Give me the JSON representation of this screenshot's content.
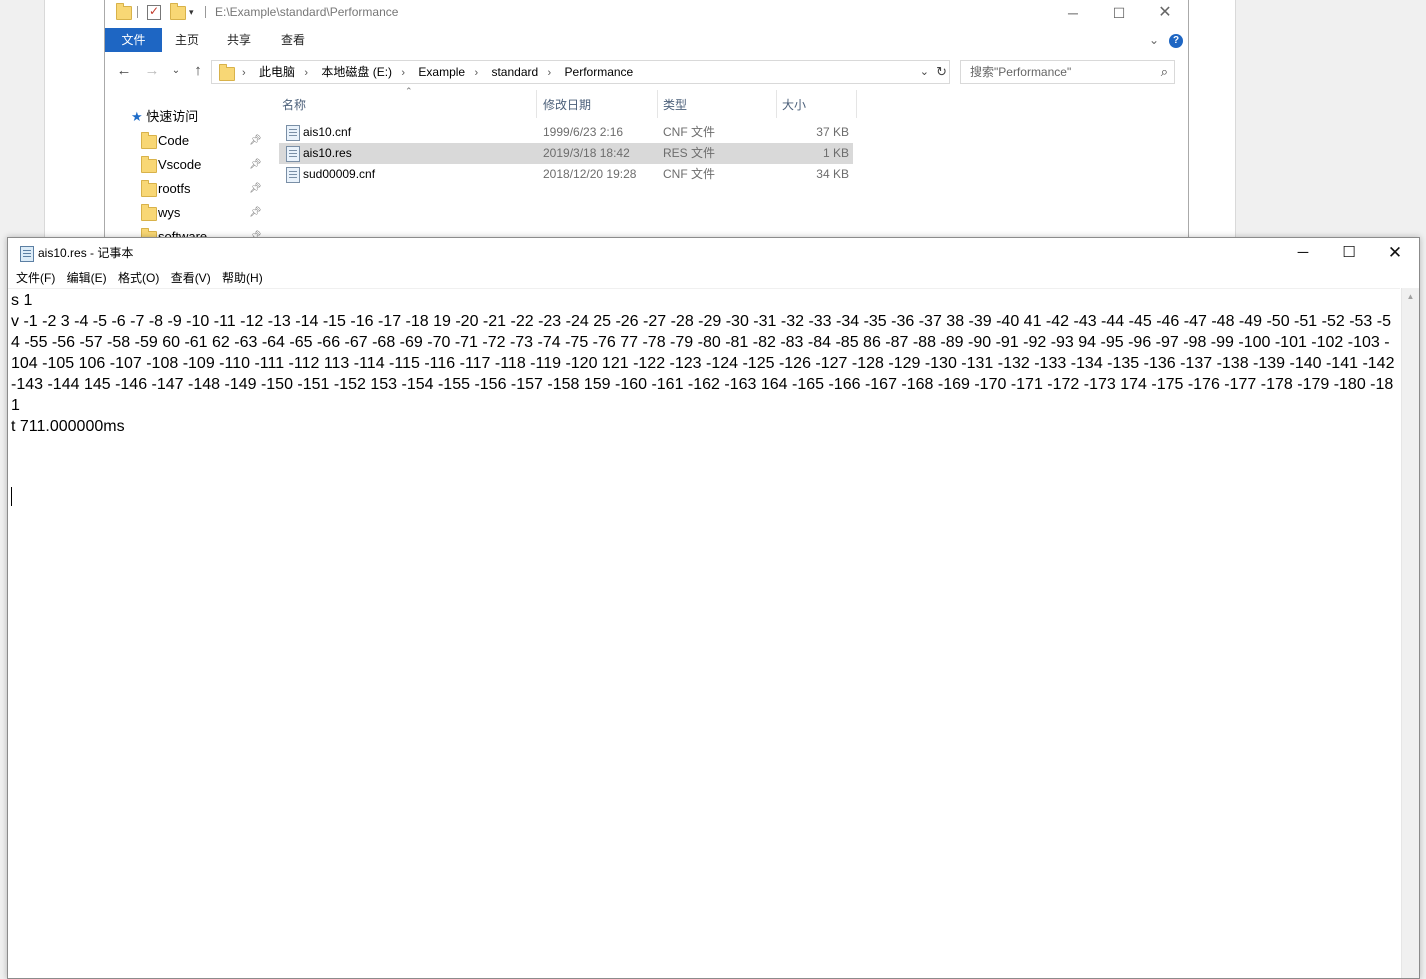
{
  "explorer": {
    "title_path": "E:\\Example\\standard\\Performance",
    "ribbon_tabs": [
      "文件",
      "主页",
      "共享",
      "查看"
    ],
    "breadcrumbs": [
      "此电脑",
      "本地磁盘 (E:)",
      "Example",
      "standard",
      "Performance"
    ],
    "search_placeholder": "搜索\"Performance\"",
    "nav": {
      "quick_access": "快速访问",
      "items": [
        "Code",
        "Vscode",
        "rootfs",
        "wys",
        "software"
      ]
    },
    "columns": {
      "name": "名称",
      "date": "修改日期",
      "type": "类型",
      "size": "大小"
    },
    "files": [
      {
        "name": "ais10.cnf",
        "date": "1999/6/23 2:16",
        "type": "CNF 文件",
        "size": "37 KB"
      },
      {
        "name": "ais10.res",
        "date": "2019/3/18 18:42",
        "type": "RES 文件",
        "size": "1 KB"
      },
      {
        "name": "sud00009.cnf",
        "date": "2018/12/20 19:28",
        "type": "CNF 文件",
        "size": "34 KB"
      }
    ]
  },
  "notepad": {
    "title": "ais10.res - 记事本",
    "menus": [
      "文件(F)",
      "编辑(E)",
      "格式(O)",
      "查看(V)",
      "帮助(H)"
    ],
    "content": "s 1\nv -1 -2 3 -4 -5 -6 -7 -8 -9 -10 -11 -12 -13 -14 -15 -16 -17 -18 19 -20 -21 -22 -23 -24 25 -26 -27 -28 -29 -30 -31 -32 -33 -34 -35 -36 -37 38 -39 -40 41 -42 -43 -44 -45 -46 -47 -48 -49 -50 -51 -52 -53 -54 -55 -56 -57 -58 -59 60 -61 62 -63 -64 -65 -66 -67 -68 -69 -70 -71 -72 -73 -74 -75 -76 77 -78 -79 -80 -81 -82 -83 -84 -85 86 -87 -88 -89 -90 -91 -92 -93 94 -95 -96 -97 -98 -99 -100 -101 -102 -103 -104 -105 106 -107 -108 -109 -110 -111 -112 113 -114 -115 -116 -117 -118 -119 -120 121 -122 -123 -124 -125 -126 -127 -128 -129 -130 -131 -132 -133 -134 -135 -136 -137 -138 -139 -140 -141 -142 -143 -144 145 -146 -147 -148 -149 -150 -151 -152 153 -154 -155 -156 -157 -158 159 -160 -161 -162 -163 164 -165 -166 -167 -168 -169 -170 -171 -172 -173 174 -175 -176 -177 -178 -179 -180 -181\nt 711.000000ms\n"
  }
}
